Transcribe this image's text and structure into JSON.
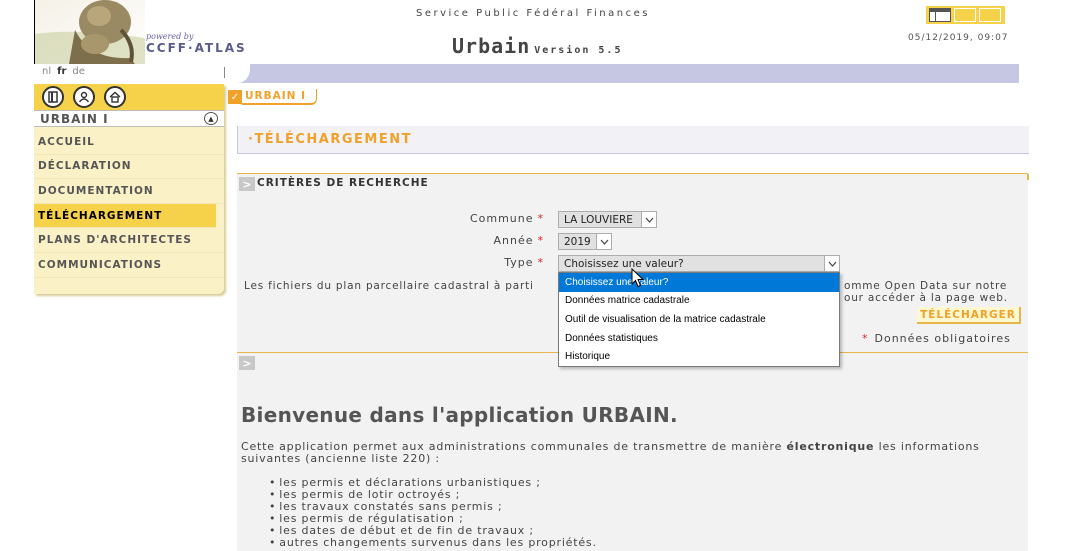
{
  "header": {
    "powered_by": "powered by",
    "brand": "CCFF·ATLAS",
    "service": "Service Public Fédéral Finances",
    "app_name": "Urbain",
    "version": "Version 5.5",
    "datetime": "05/12/2019, 09:07",
    "languages": [
      "nl",
      "fr",
      "de"
    ],
    "current_language": "fr"
  },
  "sidebar": {
    "section": "URBAIN I",
    "items": [
      {
        "label": "ACCUEIL"
      },
      {
        "label": "DÉCLARATION"
      },
      {
        "label": "DOCUMENTATION"
      },
      {
        "label": "TÉLÉCHARGEMENT",
        "active": true
      },
      {
        "label": "PLANS D'ARCHITECTES"
      },
      {
        "label": "COMMUNICATIONS"
      }
    ],
    "icons": [
      "door-icon",
      "user-icon",
      "home-icon"
    ]
  },
  "breadcrumb": {
    "label": "URBAIN I"
  },
  "page": {
    "title": "·TÉLÉCHARGEMENT",
    "criteria_title": "CRITÈRES DE RECHERCHE",
    "form": {
      "commune_label": "Commune",
      "commune_value": "LA LOUVIERE",
      "annee_label": "Année",
      "annee_value": "2019",
      "type_label": "Type",
      "type_value": "Choisissez une valeur?",
      "required_mark": "*"
    },
    "info_line1_left": "Les fichiers du plan parcellaire cadastral à parti",
    "info_line1_right": "omme Open Data sur notre",
    "info_line2_right": "our accéder à la page web.",
    "download_button": "TÉLÉCHARGER",
    "mandatory_note": "Données obligatoires"
  },
  "type_options": [
    {
      "label": "Choisissez une valeur?",
      "selected": true
    },
    {
      "label": "Données matrice cadastrale"
    },
    {
      "label": "Outil de visualisation de la matrice cadastrale"
    },
    {
      "label": "Données statistiques"
    },
    {
      "label": "Historique"
    }
  ],
  "welcome": {
    "title": "Bienvenue dans l'application URBAIN.",
    "intro_before": "Cette application permet aux administrations communales de transmettre de manière ",
    "intro_bold": "électronique",
    "intro_after": " les informations suivantes (ancienne liste 220) :",
    "bullets": [
      "les permis et déclarations urbanistiques ;",
      "les permis de lotir octroyés ;",
      "les travaux constatés sans permis ;",
      "les permis de régulatisation ;",
      "les dates de début et de fin de travaux ;",
      "autres changements survenus dans les propriétés."
    ]
  },
  "colors": {
    "accent": "#f0a12a",
    "yellow": "#f6d24a",
    "lavender": "#c5c7e3",
    "select_blue": "#0078d7"
  }
}
